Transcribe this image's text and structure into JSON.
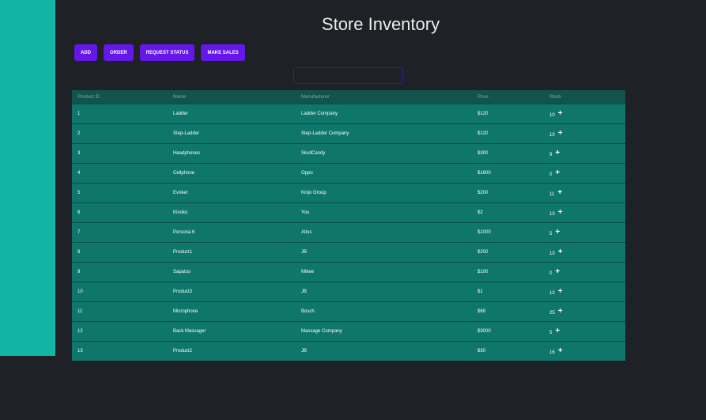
{
  "header": {
    "title": "Store Inventory"
  },
  "toolbar": {
    "add_label": "ADD",
    "order_label": "ORDER",
    "request_status_label": "REQUEST STATUS",
    "make_sales_label": "MAKE SALES"
  },
  "search": {
    "value": "",
    "placeholder": ""
  },
  "table": {
    "headers": [
      "Product ID",
      "Name",
      "Manufacturer",
      "Price",
      "Stock"
    ],
    "add_stock_icon": "plus-icon",
    "rows": [
      {
        "id": "1",
        "name": "Ladder",
        "manufacturer": "Ladder Company",
        "price": "$120",
        "stock": "10"
      },
      {
        "id": "2",
        "name": "Step-Ladder",
        "manufacturer": "Step-Ladder Company",
        "price": "$120",
        "stock": "10"
      },
      {
        "id": "3",
        "name": "Headphones",
        "manufacturer": "SkullCandy",
        "price": "$300",
        "stock": "9"
      },
      {
        "id": "4",
        "name": "Cellphone",
        "manufacturer": "Oppo",
        "price": "$1600",
        "stock": "0"
      },
      {
        "id": "5",
        "name": "Evoker",
        "manufacturer": "Kinjo Group",
        "price": "$200",
        "stock": "11"
      },
      {
        "id": "6",
        "name": "Kinoko",
        "manufacturer": "You",
        "price": "$2",
        "stock": "10"
      },
      {
        "id": "7",
        "name": "Persona 6",
        "manufacturer": "Atlus",
        "price": "$1000",
        "stock": "5"
      },
      {
        "id": "8",
        "name": "Product1",
        "manufacturer": "JB",
        "price": "$200",
        "stock": "10"
      },
      {
        "id": "9",
        "name": "Sapatos",
        "manufacturer": "Mikee",
        "price": "$100",
        "stock": "0"
      },
      {
        "id": "10",
        "name": "Product3",
        "manufacturer": "JB",
        "price": "$1",
        "stock": "10"
      },
      {
        "id": "11",
        "name": "Microphone",
        "manufacturer": "Bosch",
        "price": "$69",
        "stock": "25"
      },
      {
        "id": "12",
        "name": "Back Massager",
        "manufacturer": "Massage Company",
        "price": "$3000",
        "stock": "5"
      },
      {
        "id": "13",
        "name": "Product2",
        "manufacturer": "JB",
        "price": "$30",
        "stock": "16"
      }
    ]
  },
  "colors": {
    "sidebar": "#12b5a3",
    "background": "#1e2126",
    "button": "#6417e6",
    "table_header": "#10544d",
    "table_row": "#0f766c"
  }
}
